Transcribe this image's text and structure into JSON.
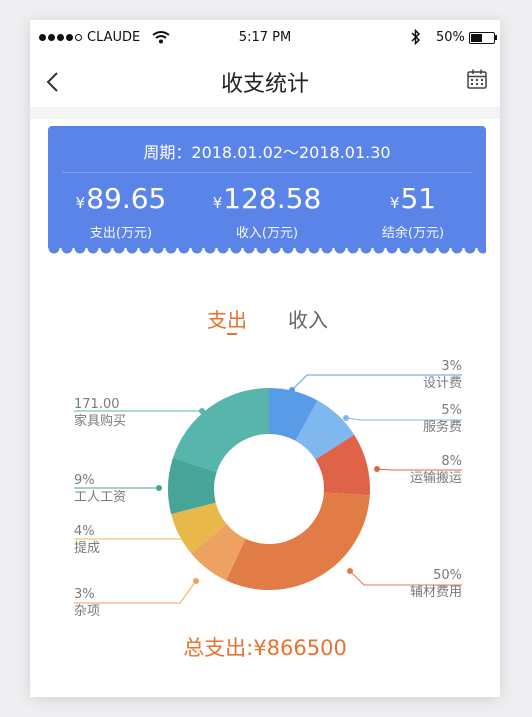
{
  "status_bar": {
    "carrier": "CLAUDE",
    "time": "5:17 PM",
    "battery": "50%",
    "battery_level": 0.5
  },
  "header": {
    "title": "收支统计",
    "back_icon": "chevron-left-icon",
    "calendar_icon": "calendar-icon"
  },
  "summary": {
    "period_label": "周期：",
    "period_range": "2018.01.02～2018.01.30",
    "currency": "¥",
    "expense": {
      "value": "89.65",
      "label": "支出(万元)"
    },
    "income": {
      "value": "128.58",
      "label": "收入(万元)"
    },
    "balance": {
      "value": "51",
      "label": "结余(万元)"
    },
    "color": "#5b84e8"
  },
  "tabs": [
    {
      "label": "支出",
      "active": true
    },
    {
      "label": "收入",
      "active": false
    }
  ],
  "chart_data": {
    "type": "pie",
    "donut": true,
    "title": "",
    "slices": [
      {
        "name": "设计费",
        "label": "3%",
        "value": 8,
        "color": "#5a9be8"
      },
      {
        "name": "服务费",
        "label": "5%",
        "value": 8,
        "color": "#7eb8ef"
      },
      {
        "name": "运输搬运",
        "label": "8%",
        "value": 10,
        "color": "#de6348"
      },
      {
        "name": "辅材费用",
        "label": "50%",
        "value": 31,
        "color": "#e27c47"
      },
      {
        "name": "杂项",
        "label": "3%",
        "value": 7,
        "color": "#eda261"
      },
      {
        "name": "提成",
        "label": "4%",
        "value": 7,
        "color": "#e8b84a"
      },
      {
        "name": "工人工资",
        "label": "9%",
        "value": 9,
        "color": "#47a598"
      },
      {
        "name": "家具购买",
        "label": "171.00",
        "value": 20,
        "color": "#58b5ab"
      }
    ]
  },
  "total": {
    "label": "总支出:",
    "currency": "¥",
    "value": "866500"
  },
  "accent_color": "#e8732f"
}
